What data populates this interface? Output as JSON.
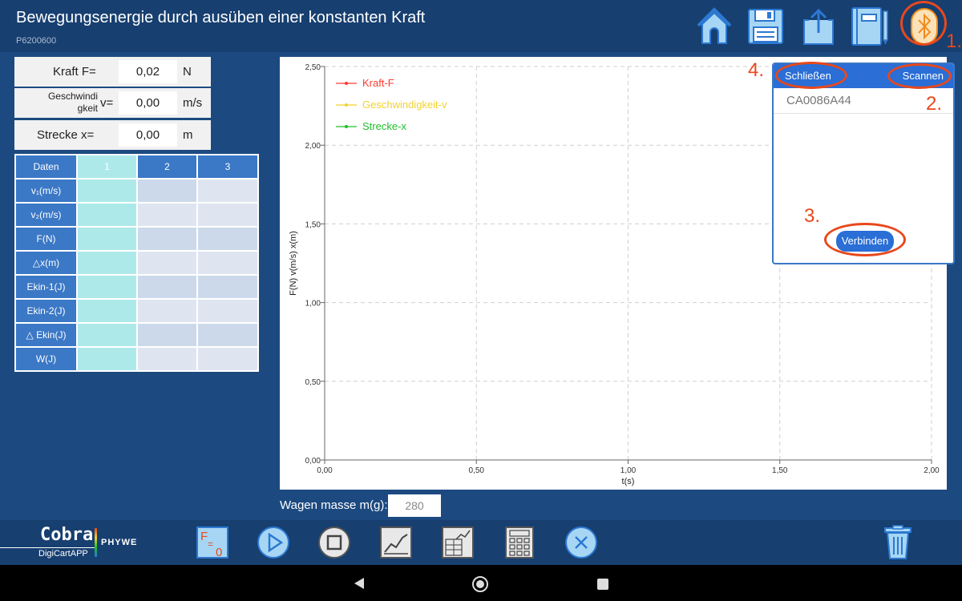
{
  "header": {
    "title": "Bewegungsenergie durch ausüben einer konstanten Kraft",
    "code": "P6200600",
    "icons": [
      "home-icon",
      "save-icon",
      "share-icon",
      "notebook-icon",
      "bluetooth-icon"
    ]
  },
  "inputs": {
    "force": {
      "label": "Kraft F=",
      "value": "0,02",
      "unit": "N"
    },
    "velocity": {
      "label_line1": "Geschwindi",
      "label_line2": "gkeit",
      "label_symbol": "v=",
      "value": "0,00",
      "unit": "m/s"
    },
    "distance": {
      "label": "Strecke x=",
      "value": "0,00",
      "unit": "m"
    }
  },
  "table": {
    "headers": [
      "Daten",
      "1",
      "2",
      "3"
    ],
    "rows": [
      {
        "label": "v₁(m/s)"
      },
      {
        "label": "v₂(m/s)"
      },
      {
        "label": "F(N)"
      },
      {
        "label": "△x(m)"
      },
      {
        "label": "Ekin-1(J)"
      },
      {
        "label": "Ekin-2(J)"
      },
      {
        "label": "△ Ekin(J)"
      },
      {
        "label": "W(J)"
      }
    ]
  },
  "chart_data": {
    "type": "line",
    "xlabel": "t(s)",
    "ylabel": "F(N) v(m/s) x(m)",
    "xlim": [
      0,
      2
    ],
    "ylim": [
      0,
      2.5
    ],
    "x_ticks": [
      "0,00",
      "0,50",
      "1,00",
      "1,50",
      "2,00"
    ],
    "y_ticks": [
      "0,00",
      "0,50",
      "1,00",
      "1,50",
      "2,00",
      "2,50"
    ],
    "grid": true,
    "legend_position": "top-left",
    "series": [
      {
        "name": "Kraft-F",
        "color": "#ff3b30",
        "values": []
      },
      {
        "name": "Geschwindigkeit-v",
        "color": "#f2d22e",
        "values": []
      },
      {
        "name": "Strecke-x",
        "color": "#1fbf2a",
        "values": []
      }
    ]
  },
  "mass": {
    "label": "Wagen masse m(g):",
    "value": "280"
  },
  "bluetooth": {
    "close_label": "Schließen",
    "scan_label": "Scannen",
    "device": "CA0086A44",
    "connect_label": "Verbinden"
  },
  "annotations": {
    "n1": "1.",
    "n2": "2.",
    "n3": "3.",
    "n4": "4."
  },
  "brand": {
    "name": "Cobra",
    "sub": "DigiCartAPP",
    "company": "PHYWE"
  },
  "colors": {
    "background": "#1c4a80",
    "header": "#173f70",
    "accent": "#3b78c6",
    "annotation": "#e8481c"
  }
}
